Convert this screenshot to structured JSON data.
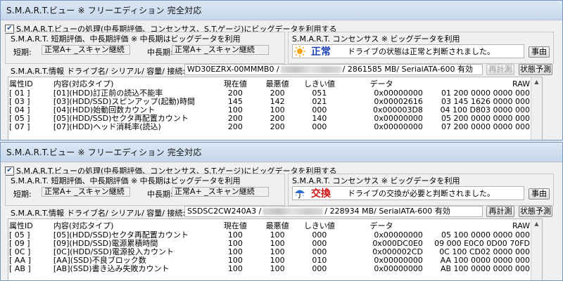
{
  "w1": {
    "title": "S.M.A.R.T.ビュー ※ フリーエディション 完全対応",
    "check_label": "S.M.A.R.T.ビューの処理(中長期評価、コンセンサス、S.T.ゲージ)にビッグデータを利用する",
    "eval_group_title": "S.M.A.R.T. 短期評価、中長期評価 ※ 中長期はビッグデータを利用",
    "short_label": "短期:",
    "short_value": "正常A+ _スキャン継続",
    "mid_label": "中長期:",
    "mid_value": "正常A+ _スキャン継続",
    "consensus_title": "S.M.A.R.T. コンセンサス ※ ビッグデータを利用",
    "status_word": "正常",
    "status_color": "#1a3fb8",
    "status_icon": "sun-icon",
    "status_message": "ドライブの状態は正常と判断されました。",
    "reason_button": "事由",
    "info_label": "S.M.A.R.T.情報",
    "drive_label": "ドライブ名/ シリアル/ 容量/ 接続:",
    "drive_model": "WD30EZRX-00MMMB0 /",
    "drive_tail": "/ 2861585 MB/ SerialATA-600 有効",
    "recalc_button": "再計測",
    "predict_button": "状態予測",
    "headers": [
      "属性ID",
      "内容(対応タイプ)",
      "現在値",
      "最悪値",
      "しきい値",
      "データ",
      "RAW"
    ],
    "rows": [
      [
        "[ 01 ]",
        "[01](HDD)訂正前の読込不能率",
        "200",
        "200",
        "051",
        "0x00000000",
        "01 200  0000 0000 000"
      ],
      [
        "[ 03 ]",
        "[03](HDD/SSD)スピンアップ(起動)時間",
        "145",
        "142",
        "021",
        "0x00002616",
        "03 145  1626 0000 000"
      ],
      [
        "[ 04 ]",
        "[04](HDD)始動回数カウント",
        "100",
        "100",
        "000",
        "0x000003D8",
        "04 100  D803 0000 000"
      ],
      [
        "[ 05 ]",
        "[05](HDD/SSD)セクタ再配置カウント",
        "200",
        "200",
        "140",
        "0x00000000",
        "05 200  0000 0000 000"
      ],
      [
        "[ 07 ]",
        "[07](HDD)ヘッド消耗率(読込)",
        "200",
        "200",
        "000",
        "0x00000000",
        "07 200  0000 0000 000"
      ]
    ]
  },
  "w2": {
    "title": "S.M.A.R.T.ビュー ※ フリーエディション 完全対応",
    "check_label": "S.M.A.R.T.ビューの処理(中長期評価、コンセンサス、S.T.ゲージ)にビッグデータを利用する",
    "eval_group_title": "S.M.A.R.T. 短期評価、中長期評価 ※ 中長期はビッグデータを利用",
    "short_label": "短期:",
    "short_value": "正常A+ _スキャン継続",
    "mid_label": "中長期:",
    "mid_value": "正常A+ _スキャン継続",
    "consensus_title": "S.M.A.R.T. コンセンサス ※ ビッグデータを利用",
    "status_word": "交換",
    "status_color": "#d01010",
    "status_icon": "umbrella-icon",
    "status_message": "ドライブの交換が必要と判断されました。",
    "reason_button": "事由",
    "info_label": "S.M.A.R.T.情報",
    "drive_label": "ドライブ名/ シリアル/ 容量/ 接続:",
    "drive_model": "SSDSC2CW240A3 /",
    "drive_tail": "/ 228934 MB/ SerialATA-600 有効",
    "recalc_button": "再計測",
    "predict_button": "状態予測",
    "headers": [
      "属性ID",
      "内容(対応タイプ)",
      "現在値",
      "最悪値",
      "しきい値",
      "データ",
      "RAW"
    ],
    "rows": [
      [
        "[ 05 ]",
        "[05](HDD/SSD)セクタ再配置カウント",
        "100",
        "100",
        "000",
        "0x00000000",
        "05 100  0000 0000 000"
      ],
      [
        "[ 09 ]",
        "[09](HDD/SSD)電源累積時間",
        "100",
        "100",
        "000",
        "0x000DC0E0",
        "09 000  E0C0 0D00 70FD"
      ],
      [
        "[ 0C ]",
        "[0C](HDD/SSD)電源投入カウント",
        "100",
        "100",
        "000",
        "0x000002CD",
        "0C 100  CD02 0000 000"
      ],
      [
        "[ AA ]",
        "[AA](SSD)不良ブロック数",
        "100",
        "100",
        "010",
        "0x00000000",
        "AA 100  0000 0000 000"
      ],
      [
        "[ AB ]",
        "[AB](SSD)書き込み失敗カウント",
        "100",
        "100",
        "000",
        "0x00000000",
        "AB 100  0000 0000 000"
      ]
    ]
  }
}
